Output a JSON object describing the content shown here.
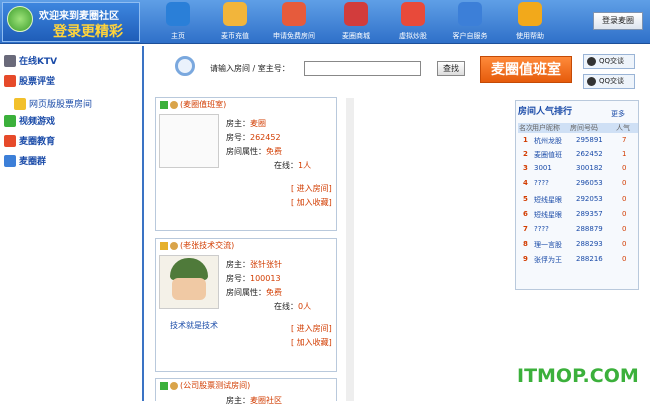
{
  "logo": {
    "line1": "欢迎来到麦圈社区",
    "line2": "登录更精彩"
  },
  "nav": [
    {
      "label": "主页",
      "icon": "globe-icon",
      "color": "#2a7fd8"
    },
    {
      "label": "麦币充值",
      "icon": "coins-icon",
      "color": "#f2b53b"
    },
    {
      "label": "申请免费房间",
      "icon": "house-icon",
      "color": "#e65b3c"
    },
    {
      "label": "麦圈商城",
      "icon": "basket-icon",
      "color": "#d23c3c"
    },
    {
      "label": "虚拟炒股",
      "icon": "chart-icon",
      "color": "#e84a3a"
    },
    {
      "label": "客户自服务",
      "icon": "gear-icon",
      "color": "#3c7fd8"
    },
    {
      "label": "使用帮助",
      "icon": "question-icon",
      "color": "#f2a91b"
    }
  ],
  "login_label": "登录麦圈",
  "sidebar": [
    {
      "label": "在线KTV",
      "icon": "phone-icon",
      "color": "#6a6a7a",
      "style": "bold"
    },
    {
      "label": "股票评堂",
      "icon": "new-badge-icon",
      "color": "#e64a2a",
      "style": "bold"
    },
    {
      "label": "网页版股票房间",
      "icon": "folder-icon",
      "color": "#f2c02b",
      "style": "sub"
    },
    {
      "label": "视频游戏",
      "icon": "game-icon",
      "color": "#3bb03b",
      "style": "bold"
    },
    {
      "label": "麦圈教育",
      "icon": "new-badge-icon",
      "color": "#e64a2a",
      "style": "bold"
    },
    {
      "label": "麦圈群",
      "icon": "people-icon",
      "color": "#3c7fd8",
      "style": "bold"
    }
  ],
  "search": {
    "label": "请输入房间 / 室主号：",
    "value": "",
    "button": "查找"
  },
  "banner": "麦圈值班室",
  "qq": [
    "QQ交谈",
    "QQ交谈"
  ],
  "rooms": [
    {
      "title": "(麦圈值班室)",
      "owner_label": "房主：",
      "owner": "麦圈",
      "id_label": "房号：",
      "id": "262452",
      "attr_label": "房间属性：",
      "attr": "免费",
      "online_label": "在线：",
      "online": "1人",
      "enter": "[ 进入房间]",
      "fav": "[ 加入收藏]",
      "desc": ""
    },
    {
      "title": "(老张技术交流)",
      "owner_label": "房主：",
      "owner": "张针张针",
      "id_label": "房号：",
      "id": "100013",
      "attr_label": "房间属性：",
      "attr": "免费",
      "online_label": "在线：",
      "online": "0人",
      "enter": "[ 进入房间]",
      "fav": "[ 加入收藏]",
      "desc": "技术就是技术"
    },
    {
      "title": "(公司股票测试房间)",
      "owner_label": "房主：",
      "owner": "麦圈社区",
      "id_label": "",
      "id": "",
      "attr_label": "",
      "attr": "",
      "online_label": "",
      "online": "",
      "enter": "",
      "fav": "",
      "desc": ""
    }
  ],
  "ranking": {
    "title": "房间人气排行",
    "more": "更多",
    "headers": [
      "名次",
      "用户昵称",
      "房间号码",
      "人气"
    ],
    "rows": [
      {
        "rank": "1",
        "name": "杭州龙股",
        "room": "295891",
        "pop": "7"
      },
      {
        "rank": "2",
        "name": "麦圈值班",
        "room": "262452",
        "pop": "1"
      },
      {
        "rank": "3",
        "name": "3001",
        "room": "300182",
        "pop": "0"
      },
      {
        "rank": "4",
        "name": "????",
        "room": "296053",
        "pop": "0"
      },
      {
        "rank": "5",
        "name": "短线星眼",
        "room": "292053",
        "pop": "0"
      },
      {
        "rank": "6",
        "name": "短线星眼",
        "room": "289357",
        "pop": "0"
      },
      {
        "rank": "7",
        "name": "????",
        "room": "288879",
        "pop": "0"
      },
      {
        "rank": "8",
        "name": "理一言股",
        "room": "288293",
        "pop": "0"
      },
      {
        "rank": "9",
        "name": "张俘为王",
        "room": "288216",
        "pop": "0"
      }
    ]
  },
  "watermark": "ITMOP.COM"
}
